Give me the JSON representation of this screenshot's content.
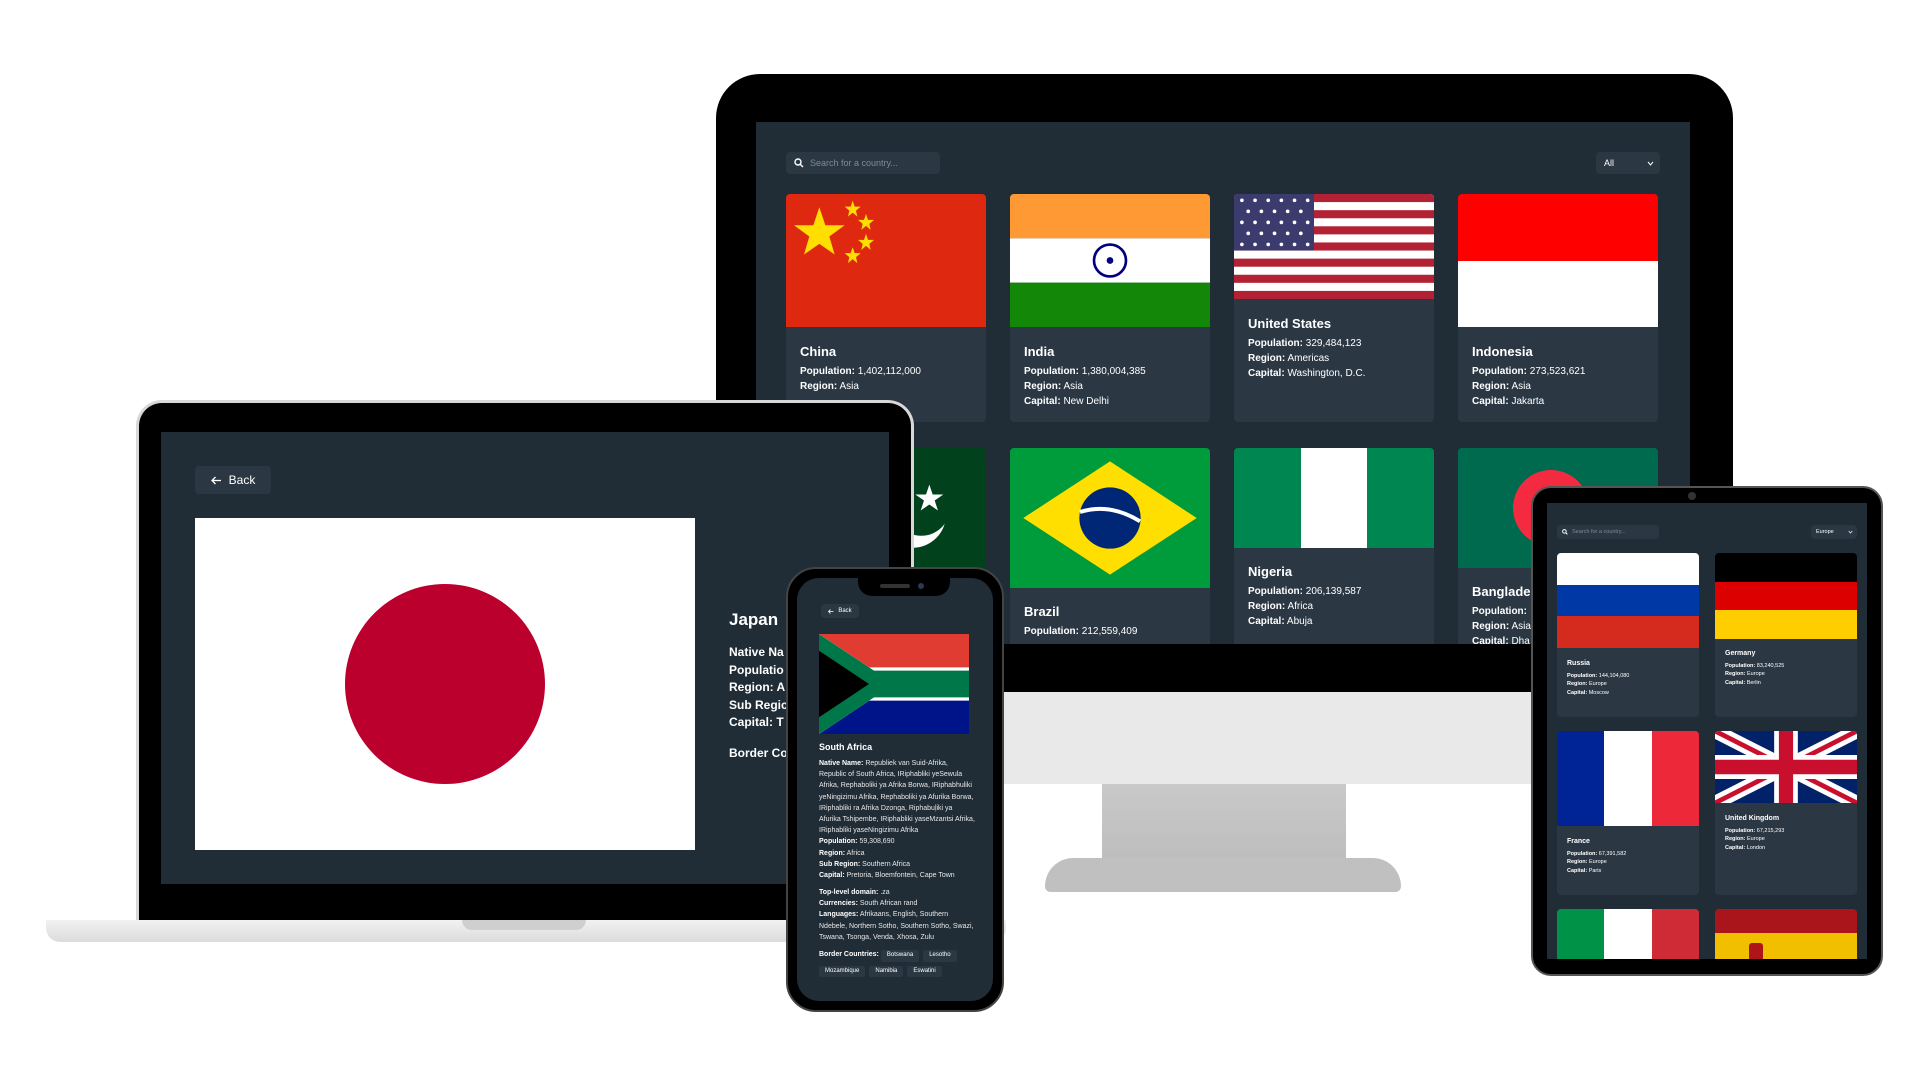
{
  "monitor": {
    "search_placeholder": "Search for a country...",
    "filter_value": "All",
    "labels": {
      "population": "Population:",
      "region": "Region:",
      "capital": "Capital:"
    },
    "cards": [
      {
        "name": "China",
        "population": "1,402,112,000",
        "region": "Asia",
        "capital": ""
      },
      {
        "name": "India",
        "population": "1,380,004,385",
        "region": "Asia",
        "capital": "New Delhi"
      },
      {
        "name": "United States",
        "population": "329,484,123",
        "region": "Americas",
        "capital": "Washington, D.C."
      },
      {
        "name": "Indonesia",
        "population": "273,523,621",
        "region": "Asia",
        "capital": "Jakarta"
      },
      {
        "name": "Brazil",
        "population": "212,559,409"
      },
      {
        "name": "Nigeria",
        "population": "206,139,587",
        "region": "Africa",
        "capital": "Abuja"
      },
      {
        "name": "Banglade",
        "population": "",
        "region": "Asia",
        "capital": "Dha"
      }
    ]
  },
  "laptop": {
    "back_label": "Back",
    "country_name": "Japan",
    "fields": [
      "Native Na",
      "Populatio",
      "Region: A",
      "Sub Regic",
      "Capital: T"
    ],
    "border_label": "Border Co"
  },
  "phone": {
    "back_label": "Back",
    "country_name": "South Africa",
    "labels": {
      "native": "Native Name:",
      "population": "Population:",
      "region": "Region:",
      "sub_region": "Sub Region:",
      "capital": "Capital:",
      "tld": "Top-level domain:",
      "currencies": "Currencies:",
      "languages": "Languages:",
      "borders": "Border Countries:"
    },
    "native_name": "Republiek van Suid-Afrika, Republic of South Africa, IRiphabliki yeSewula Afrika, Rephaboliki ya Afrika Borwa, IRiphabhuliki yeNingizimu Afrika, Rephaboliki ya Afurika Borwa, IRiphabliki ra Afrika Dzonga, Riphabuļiki ya Afurika Tshipembe, IRiphabliki yaseMzantsi Afrika, IRiphabliki yaseNingizimu Afrika",
    "population": "59,308,690",
    "region": "Africa",
    "sub_region": "Southern Africa",
    "capital": "Pretoria, Bloemfontein, Cape Town",
    "tld": ".za",
    "currencies": "South African rand",
    "languages": "Afrikaans, English, Southern Ndebele, Northern Sotho, Southern Sotho, Swazi, Tswana, Tsonga, Venda, Xhosa, Zulu",
    "borders": [
      "Botswana",
      "Lesotho",
      "Mozambique",
      "Namibia",
      "Eswatini"
    ]
  },
  "tablet": {
    "search_placeholder": "Search for a country...",
    "filter_value": "Europe",
    "labels": {
      "population": "Population:",
      "region": "Region:",
      "capital": "Capital:"
    },
    "cards": [
      {
        "name": "Russia",
        "population": "144,104,080",
        "region": "Europe",
        "capital": "Moscow"
      },
      {
        "name": "Germany",
        "population": "83,240,525",
        "region": "Europe",
        "capital": "Berlin"
      },
      {
        "name": "France",
        "population": "67,391,582",
        "region": "Europe",
        "capital": "Paris"
      },
      {
        "name": "United Kingdom",
        "population": "67,215,293",
        "region": "Europe",
        "capital": "London"
      }
    ]
  },
  "colors": {
    "bg": "#202c36",
    "element": "#2b3844",
    "text": "#ffffff",
    "japan_red": "#bc002d"
  }
}
